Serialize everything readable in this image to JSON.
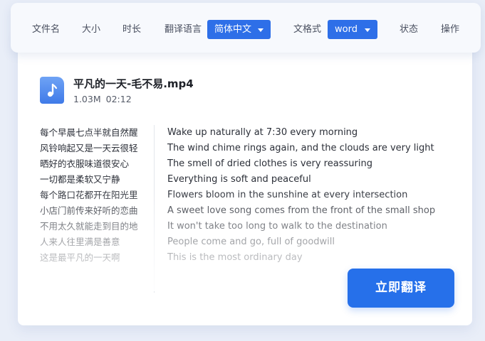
{
  "header": {
    "col_filename": "文件名",
    "col_size": "大小",
    "col_duration": "时长",
    "col_translate_lang": "翻译语言",
    "lang_select_value": "简体中文",
    "col_format": "文格式",
    "format_select_value": "word",
    "col_status": "状态",
    "col_action": "操作"
  },
  "file": {
    "icon": "music-note-icon",
    "name": "平凡的一天-毛不易.mp4",
    "size": "1.03M",
    "duration": "02:12"
  },
  "lyrics_cn": [
    "每个早晨七点半就自然醒",
    "风铃响起又是一天云很轻",
    "晒好的衣服味道很安心",
    "一切都是柔软又宁静",
    "每个路口花都开在阳光里",
    "小店门前传来好听的恋曲",
    "不用太久就能走到目的地",
    "人来人往里满是善意",
    "这是最平凡的一天啊"
  ],
  "lyrics_en": [
    "Wake up naturally at 7:30 every morning",
    "The wind chime rings again, and the clouds are very light",
    "The smell of dried clothes is very reassuring",
    "Everything is soft and peaceful",
    "Flowers bloom in the sunshine at every intersection",
    "A sweet love song comes from the front of the small shop",
    "It won't take too long to walk to the destination",
    "People come and go, full of goodwill",
    "This is the most ordinary day"
  ],
  "actions": {
    "translate_button": "立即翻译"
  },
  "colors": {
    "accent": "#2670ea",
    "dropdown": "#2e6fe8",
    "background": "#e9eef8"
  }
}
